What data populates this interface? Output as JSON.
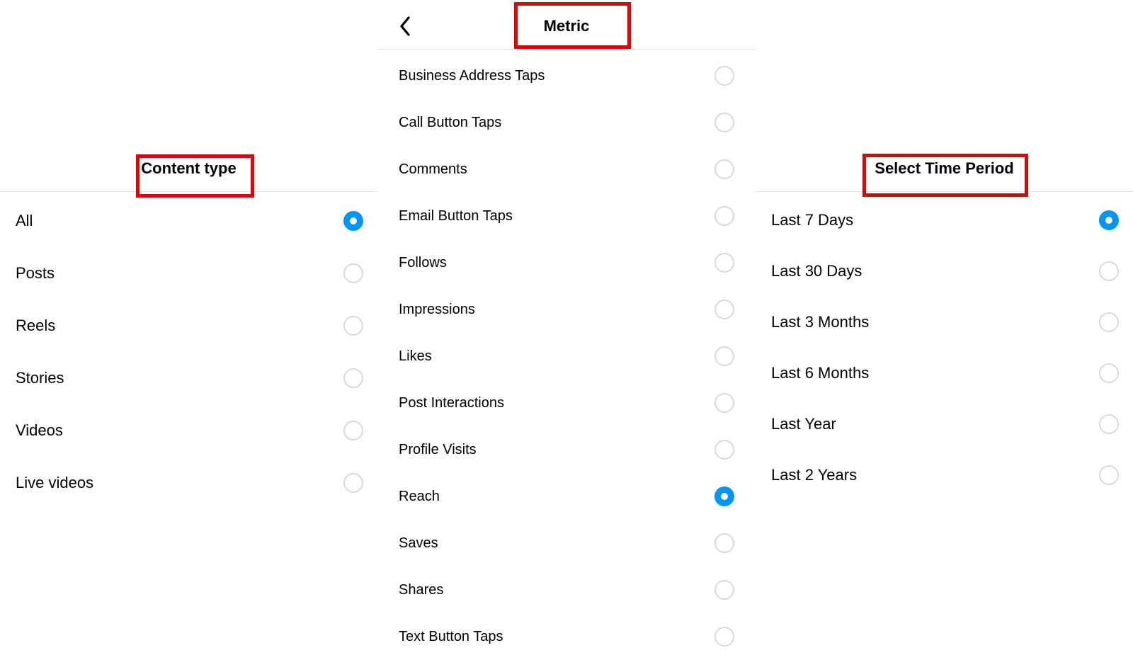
{
  "left": {
    "title": "Content type",
    "items": [
      {
        "label": "All",
        "selected": true
      },
      {
        "label": "Posts",
        "selected": false
      },
      {
        "label": "Reels",
        "selected": false
      },
      {
        "label": "Stories",
        "selected": false
      },
      {
        "label": "Videos",
        "selected": false
      },
      {
        "label": "Live videos",
        "selected": false
      }
    ]
  },
  "mid": {
    "title": "Metric",
    "items": [
      {
        "label": "Business Address Taps",
        "selected": false
      },
      {
        "label": "Call Button Taps",
        "selected": false
      },
      {
        "label": "Comments",
        "selected": false
      },
      {
        "label": "Email Button Taps",
        "selected": false
      },
      {
        "label": "Follows",
        "selected": false
      },
      {
        "label": "Impressions",
        "selected": false
      },
      {
        "label": "Likes",
        "selected": false
      },
      {
        "label": "Post Interactions",
        "selected": false
      },
      {
        "label": "Profile Visits",
        "selected": false
      },
      {
        "label": "Reach",
        "selected": true
      },
      {
        "label": "Saves",
        "selected": false
      },
      {
        "label": "Shares",
        "selected": false
      },
      {
        "label": "Text Button Taps",
        "selected": false
      }
    ]
  },
  "right": {
    "title": "Select Time Period",
    "items": [
      {
        "label": "Last 7 Days",
        "selected": true
      },
      {
        "label": "Last 30 Days",
        "selected": false
      },
      {
        "label": "Last 3 Months",
        "selected": false
      },
      {
        "label": "Last 6 Months",
        "selected": false
      },
      {
        "label": "Last Year",
        "selected": false
      },
      {
        "label": "Last 2 Years",
        "selected": false
      }
    ]
  }
}
